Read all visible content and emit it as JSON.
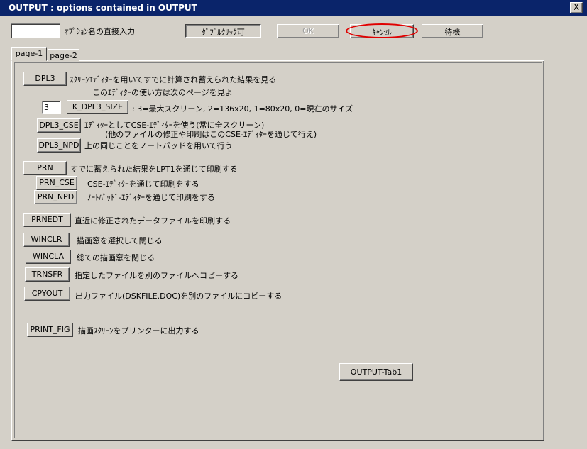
{
  "window": {
    "title": "OUTPUT : options contained in OUTPUT",
    "close_label": "X"
  },
  "toolbar": {
    "direct_input_value": "",
    "direct_input_label": "ｵﾌﾟｼｮﾝ名の直接入力",
    "doubleclick_label": "ﾀﾞﾌﾞﾙｸﾘｯｸ可",
    "ok_label": "OK",
    "cancel_label": "ｷｬﾝｾﾙ",
    "wait_label": "待機"
  },
  "tabs": [
    {
      "label": "page-1",
      "active": true
    },
    {
      "label": "page-2",
      "active": false
    }
  ],
  "options": {
    "dpl3": {
      "button": "DPL3",
      "desc": "ｽｸﾘｰﾝｴﾃﾞｨﾀｰを用いてすでに計算され蓄えられた結果を見る",
      "desc2": "このｴﾃﾞｨﾀｰの使い方は次のページを見よ"
    },
    "k_dpl3_size": {
      "value": "3",
      "button": "K_DPL3_SIZE",
      "desc": ": 3=最大スクリーン, 2=136x20, 1=80x20, 0=現在のサイズ"
    },
    "dpl3_cse": {
      "button": "DPL3_CSE",
      "desc": "ｴﾃﾞｨﾀｰとしてCSE-ｴﾃﾞｨﾀｰを使う(常に全スクリーン)",
      "desc2": "(他のファイルの修正や印刷はこのCSE-ｴﾃﾞｨﾀｰを通じて行え)"
    },
    "dpl3_npd": {
      "button": "DPL3_NPD",
      "desc": "上の同じことをノートパッドを用いて行う"
    },
    "prn": {
      "button": "PRN",
      "desc": "すでに蓄えられた結果をLPT1を通じて印刷する"
    },
    "prn_cse": {
      "button": "PRN_CSE",
      "desc": "CSE-ｴﾃﾞｨﾀｰを通じて印刷をする"
    },
    "prn_npd": {
      "button": "PRN_NPD",
      "desc": "ﾉｰﾄﾊﾟｯﾄﾞ-ｴﾃﾞｨﾀｰを通じて印刷をする"
    },
    "prnedt": {
      "button": "PRNEDT",
      "desc": "直近に修正されたデータファイルを印刷する"
    },
    "winclr": {
      "button": "WINCLR",
      "desc": "描画窓を選択して閉じる"
    },
    "wincla": {
      "button": "WINCLA",
      "desc": "総ての描画窓を閉じる"
    },
    "trnsfr": {
      "button": "TRNSFR",
      "desc": "指定したファイルを別のファイルへコピーする"
    },
    "cpyout": {
      "button": "CPYOUT",
      "desc": "出力ファイル(DSKFILE.DOC)を別のファイルにコピーする"
    },
    "print_fig": {
      "button": "PRINT_FIG",
      "desc": "描画ｽｸﾘｰﾝをプリンターに出力する"
    }
  },
  "footer": {
    "tab_button": "OUTPUT-Tab1"
  },
  "highlight": {
    "color": "#e00000",
    "target": "cancel-button"
  }
}
